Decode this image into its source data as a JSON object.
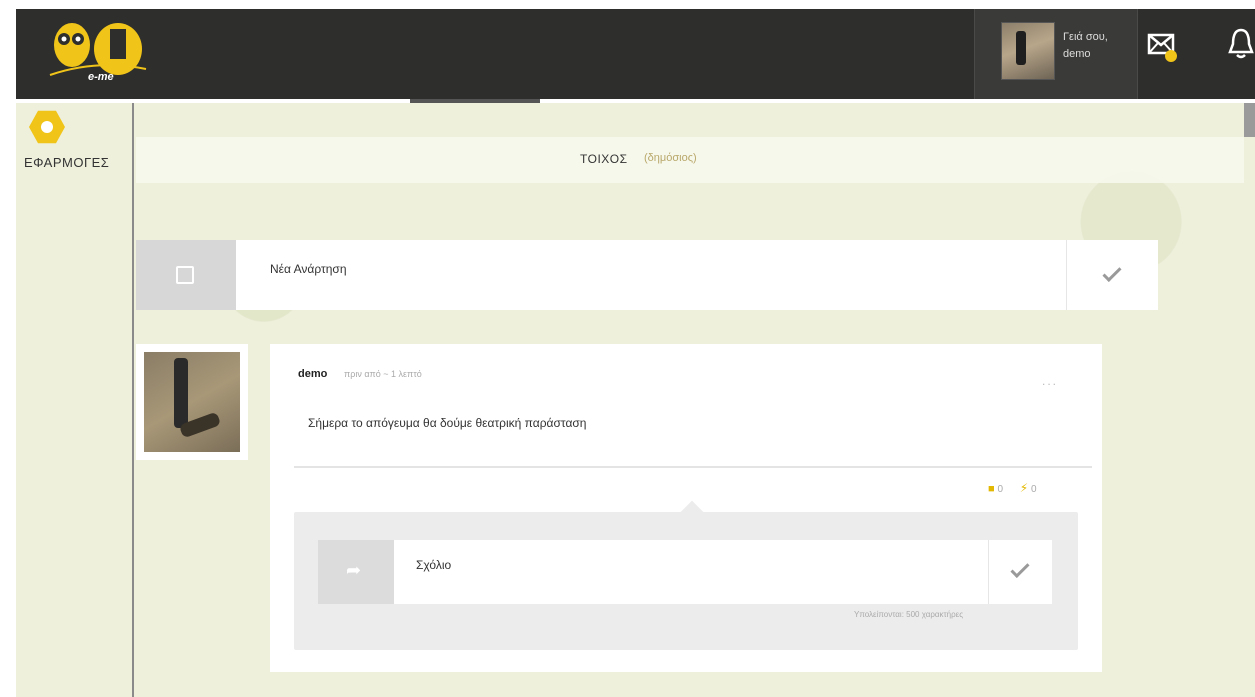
{
  "header": {
    "logo_text": "e-me",
    "greeting_line1": "Γειά σου,",
    "greeting_line2": "demo"
  },
  "sidebar": {
    "apps_label": "ΕΦΑΡΜΟΓΕΣ"
  },
  "wall": {
    "title": "ΤΟΙΧΟΣ",
    "subtitle": "(δημόσιος)"
  },
  "composer": {
    "placeholder": "Νέα Ανάρτηση"
  },
  "post": {
    "author": "demo",
    "time": "πριν από ~ 1 λεπτό",
    "menu": "...",
    "body": "Σήμερα το απόγευμα θα δούμε θεατρική παράσταση",
    "likes": "0",
    "bolts": "0"
  },
  "comment": {
    "placeholder": "Σχόλιο",
    "hint": "Υπολείπονται: 500 χαρακτήρες"
  },
  "colors": {
    "accent": "#f0c419",
    "topbar": "#2e2e2c",
    "background": "#eef0dc"
  }
}
